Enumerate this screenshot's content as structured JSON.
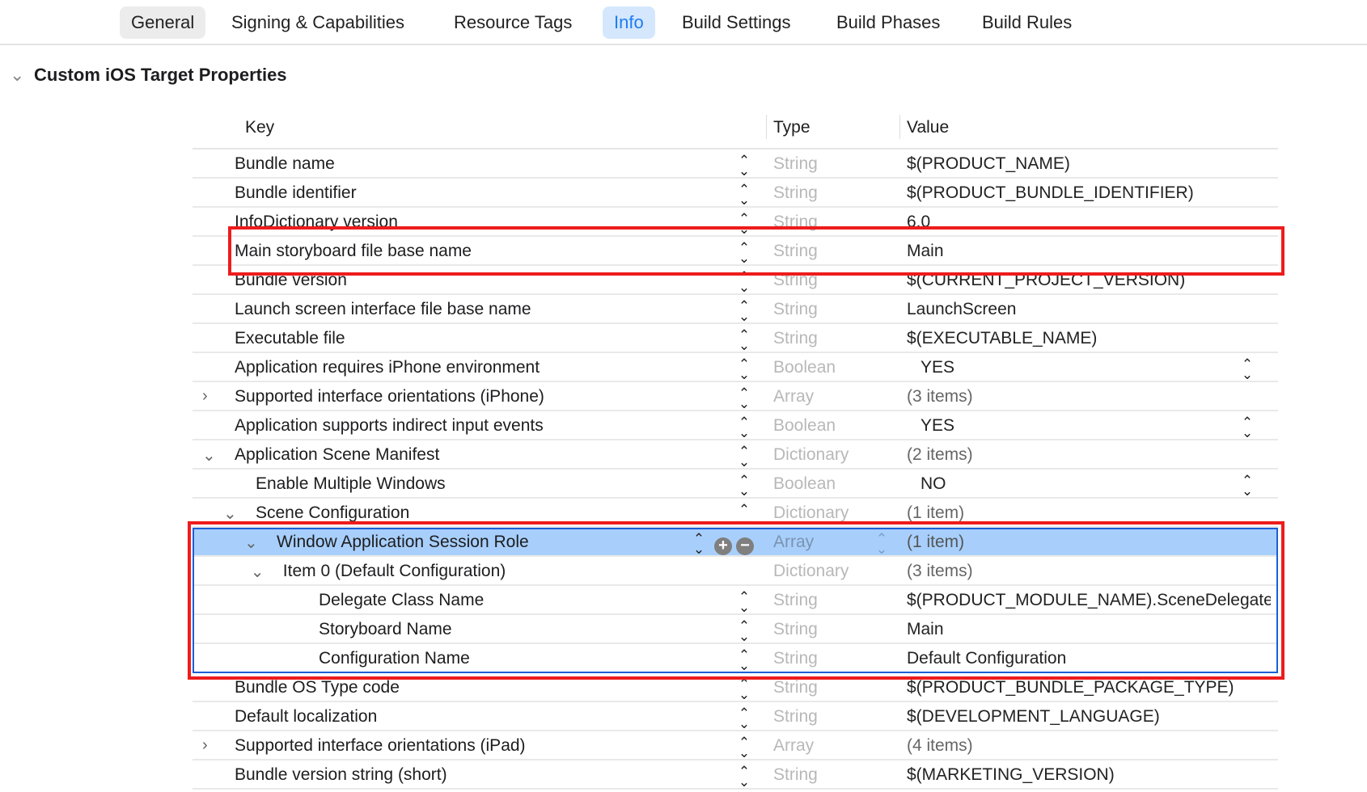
{
  "tabs": [
    "General",
    "Signing & Capabilities",
    "Resource Tags",
    "Info",
    "Build Settings",
    "Build Phases",
    "Build Rules"
  ],
  "active_tab": "Info",
  "section_title": "Custom iOS Target Properties",
  "columns": {
    "key": "Key",
    "type": "Type",
    "value": "Value"
  },
  "rows": [
    {
      "key": "Bundle name",
      "type": "String",
      "value": "$(PRODUCT_NAME)",
      "level": 0
    },
    {
      "key": "Bundle identifier",
      "type": "String",
      "value": "$(PRODUCT_BUNDLE_IDENTIFIER)",
      "level": 0
    },
    {
      "key": "InfoDictionary version",
      "type": "String",
      "value": "6.0",
      "level": 0
    },
    {
      "key": "Main storyboard file base name",
      "type": "String",
      "value": "Main",
      "level": 0
    },
    {
      "key": "Bundle version",
      "type": "String",
      "value": "$(CURRENT_PROJECT_VERSION)",
      "level": 0
    },
    {
      "key": "Launch screen interface file base name",
      "type": "String",
      "value": "LaunchScreen",
      "level": 0
    },
    {
      "key": "Executable file",
      "type": "String",
      "value": "$(EXECUTABLE_NAME)",
      "level": 0
    },
    {
      "key": "Application requires iPhone environment",
      "type": "Boolean",
      "value": "YES",
      "level": 0,
      "popup": true
    },
    {
      "key": "Supported interface orientations (iPhone)",
      "type": "Array",
      "value": "(3 items)",
      "level": 0,
      "disclosure": "collapsed"
    },
    {
      "key": "Application supports indirect input events",
      "type": "Boolean",
      "value": "YES",
      "level": 0,
      "popup": true
    },
    {
      "key": "Application Scene Manifest",
      "type": "Dictionary",
      "value": "(2 items)",
      "level": 0,
      "disclosure": "expanded"
    },
    {
      "key": "Enable Multiple Windows",
      "type": "Boolean",
      "value": "NO",
      "level": 1,
      "popup": true
    },
    {
      "key": "Scene Configuration",
      "type": "Dictionary",
      "value": "(1 item)",
      "level": 1,
      "disclosure": "expanded"
    },
    {
      "key": "Window Application Session Role",
      "type": "Array",
      "value": "(1 item)",
      "level": 2,
      "disclosure": "expanded",
      "selected": true
    },
    {
      "key": "Item 0 (Default Configuration)",
      "type": "Dictionary",
      "value": "(3 items)",
      "level": 2.3,
      "disclosure": "expanded",
      "nostep": true
    },
    {
      "key": "Delegate Class Name",
      "type": "String",
      "value": "$(PRODUCT_MODULE_NAME).SceneDelegate",
      "level": 4
    },
    {
      "key": "Storyboard Name",
      "type": "String",
      "value": "Main",
      "level": 4
    },
    {
      "key": "Configuration Name",
      "type": "String",
      "value": "Default Configuration",
      "level": 4
    },
    {
      "key": "Bundle OS Type code",
      "type": "String",
      "value": "$(PRODUCT_BUNDLE_PACKAGE_TYPE)",
      "level": 0
    },
    {
      "key": "Default localization",
      "type": "String",
      "value": "$(DEVELOPMENT_LANGUAGE)",
      "level": 0
    },
    {
      "key": "Supported interface orientations (iPad)",
      "type": "Array",
      "value": "(4 items)",
      "level": 0,
      "disclosure": "collapsed"
    },
    {
      "key": "Bundle version string (short)",
      "type": "String",
      "value": "$(MARKETING_VERSION)",
      "level": 0
    }
  ],
  "colors": {
    "accent": "#1f7cf2",
    "selection": "#a8cffb",
    "highlight_box": "#ee1c1c"
  }
}
